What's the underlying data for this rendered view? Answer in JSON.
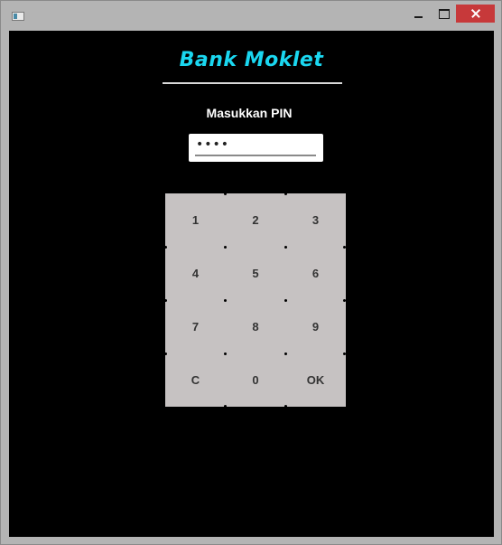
{
  "window": {
    "title": ""
  },
  "app": {
    "title": "Bank Moklet",
    "pin_label": "Masukkan PIN",
    "pin_value": "••••"
  },
  "keypad": {
    "keys": [
      "1",
      "2",
      "3",
      "4",
      "5",
      "6",
      "7",
      "8",
      "9",
      "C",
      "0",
      "OK"
    ]
  },
  "colors": {
    "title": "#1ad7f0",
    "background": "#000000",
    "keypad": "#c6c2c2",
    "close_button": "#c7393a"
  }
}
